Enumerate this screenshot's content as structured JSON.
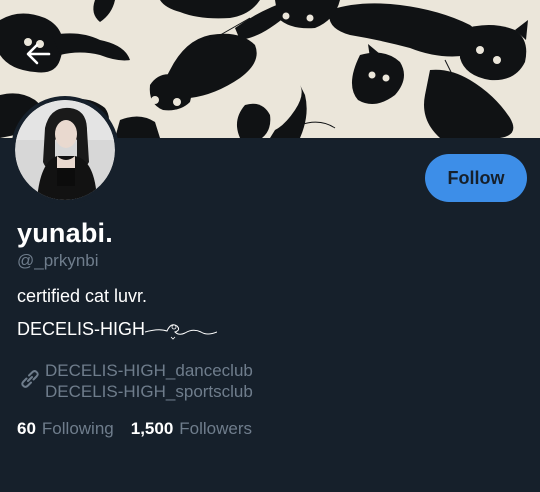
{
  "profile": {
    "display_name": "yunabi.",
    "handle": "@_prkynbi",
    "bio_line1": "certified cat luvr.",
    "bio_line2": "DECELIS-HIGH",
    "links": [
      "DECELIS-HIGH_danceclub",
      "DECELIS-HIGH_sportsclub"
    ]
  },
  "stats": {
    "following_count": "60",
    "following_label": "Following",
    "followers_count": "1,500",
    "followers_label": "Followers"
  },
  "actions": {
    "follow_label": "Follow"
  },
  "icons": {
    "back": "arrow-left-icon",
    "link": "link-icon"
  },
  "colors": {
    "background": "#16202b",
    "accent": "#3d8ee8",
    "muted_text": "#6f7d8c",
    "banner_bg": "#ebe6da"
  }
}
